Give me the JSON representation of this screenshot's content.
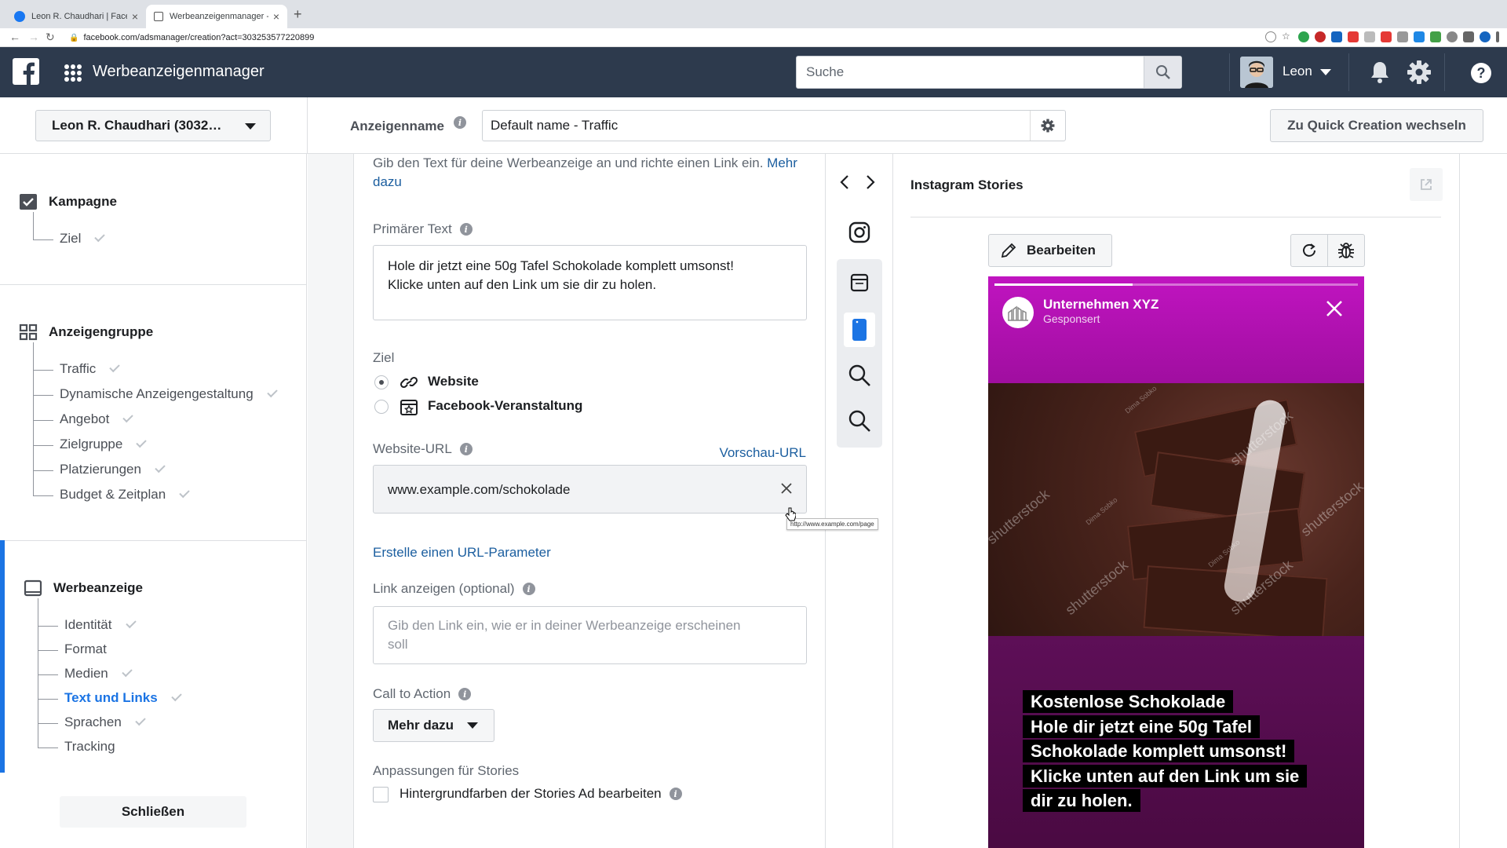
{
  "browser": {
    "tabs": [
      {
        "title": "Leon R. Chaudhari | Facebook",
        "active": false
      },
      {
        "title": "Werbeanzeigenmanager - Cre…",
        "active": true
      }
    ],
    "url": "facebook.com/adsmanager/creation?act=303253577220899"
  },
  "header": {
    "app_title": "Werbeanzeigenmanager",
    "search_placeholder": "Suche",
    "user_name": "Leon",
    "brand_color": "#2d3a4d"
  },
  "subheader": {
    "account": "Leon R. Chaudhari (3032…",
    "ad_name_label": "Anzeigenname",
    "ad_name_value": "Default name - Traffic",
    "quick_creation": "Zu Quick Creation wechseln"
  },
  "sidebar": {
    "campaign": {
      "title": "Kampagne",
      "items": [
        {
          "label": "Ziel",
          "done": true
        }
      ]
    },
    "adset": {
      "title": "Anzeigengruppe",
      "items": [
        {
          "label": "Traffic",
          "done": true
        },
        {
          "label": "Dynamische Anzeigengestaltung",
          "done": true
        },
        {
          "label": "Angebot",
          "done": true
        },
        {
          "label": "Zielgruppe",
          "done": true
        },
        {
          "label": "Platzierungen",
          "done": true
        },
        {
          "label": "Budget & Zeitplan",
          "done": true
        }
      ]
    },
    "ad": {
      "title": "Werbeanzeige",
      "items": [
        {
          "label": "Identität",
          "done": true
        },
        {
          "label": "Format",
          "done": false
        },
        {
          "label": "Medien",
          "done": true
        },
        {
          "label": "Text und Links",
          "done": true,
          "active": true
        },
        {
          "label": "Sprachen",
          "done": true
        },
        {
          "label": "Tracking",
          "done": false
        }
      ]
    },
    "close_label": "Schließen",
    "accent_color": "#1b74e4"
  },
  "form": {
    "intro_text": "Gib den Text für deine Werbeanzeige an und richte einen Link ein.",
    "intro_link_1": "Mehr",
    "intro_link_2": "dazu",
    "primary_text_label": "Primärer Text",
    "primary_text_line1": "Hole dir jetzt eine 50g Tafel Schokolade komplett umsonst!",
    "primary_text_line2": "Klicke unten auf den Link um sie dir zu holen.",
    "goal_label": "Ziel",
    "goal_options": [
      {
        "label": "Website",
        "selected": true
      },
      {
        "label": "Facebook-Veranstaltung",
        "selected": false
      }
    ],
    "website_url_label": "Website-URL",
    "preview_url_link": "Vorschau-URL",
    "website_url_value": "www.example.com/schokolade",
    "tooltip_text": "http://www.example.com/page",
    "url_param_link": "Erstelle einen URL-Parameter",
    "display_link_label": "Link anzeigen",
    "display_link_optional": "(optional)",
    "display_link_placeholder_line1": "Gib den Link ein, wie er in deiner Werbeanzeige erscheinen",
    "display_link_placeholder_line2": "soll",
    "cta_label": "Call to Action",
    "cta_value": "Mehr dazu",
    "stories_label": "Anpassungen für Stories",
    "stories_checkbox_label": "Hintergrundfarben der Stories Ad bearbeiten",
    "stories_checkbox_checked": false
  },
  "preview": {
    "title": "Instagram Stories",
    "edit_label": "Bearbeiten",
    "story": {
      "page_name": "Unternehmen XYZ",
      "sponsored": "Gesponsert",
      "watermark": "shutterstock",
      "watermark_author": "Dima Sobko",
      "progress": 0.38,
      "caption_lines": [
        "Kostenlose Schokolade",
        "Hole dir jetzt eine 50g Tafel",
        "Schokolade komplett umsonst!",
        "Klicke unten auf den Link um sie",
        "dir zu holen."
      ],
      "bg_color": "#a80ea8"
    }
  },
  "placements": [
    "instagram-icon",
    "browser-icon",
    "mobile-story-icon",
    "search-icon",
    "search-icon"
  ]
}
